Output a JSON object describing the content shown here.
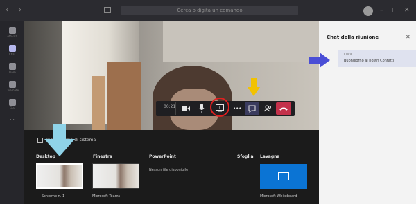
{
  "topbar": {
    "search_text": "Cerca o digita un comando",
    "nav_glyphs": "‹ ›",
    "window_minimize": "–",
    "window_maximize": "□",
    "window_close": "✕"
  },
  "left_rail": {
    "items": [
      {
        "label": "Attività",
        "icon": "bell-icon"
      },
      {
        "label": "Chat",
        "icon": "chat-icon"
      },
      {
        "label": "Team",
        "icon": "team-icon"
      },
      {
        "label": "Chiamate",
        "icon": "phone-icon"
      },
      {
        "label": "File",
        "icon": "file-icon"
      },
      {
        "label": "...",
        "icon": "more-icon"
      }
    ]
  },
  "call_controls": {
    "timer": "00:21",
    "camera_icon": "camera-icon",
    "mic_icon": "microphone-icon",
    "share_icon": "share-screen-icon",
    "more_label": "•••",
    "chat_icon": "chat-icon",
    "participants_icon": "participants-icon",
    "hangup_icon": "phone-hangup-icon"
  },
  "share_tray": {
    "include_audio_label": "Includi audio di sistema",
    "sections": {
      "desktop": "Desktop",
      "window": "Finestra",
      "powerpoint": "PowerPoint",
      "browse": "Sfoglia",
      "whiteboard": "Lavagna"
    },
    "desktop_caption": "Schermo n. 1",
    "window_caption": "Microsoft Teams",
    "powerpoint_empty": "Nessun file disponibile",
    "whiteboard_caption": "Microsoft Whiteboard"
  },
  "side_panel": {
    "title": "Chat della riunione",
    "message": {
      "sender": "Luca",
      "text": "Buongiorno ai nostri Contatti"
    }
  },
  "colors": {
    "accent": "#6264a7",
    "hangup": "#c4314b",
    "whiteboard": "#0b74d4",
    "yellow_arrow": "#f2c200",
    "blue_arrow": "#8fd3e8",
    "purple_arrow": "#4a4ed6",
    "highlight_circle": "#e02020"
  }
}
